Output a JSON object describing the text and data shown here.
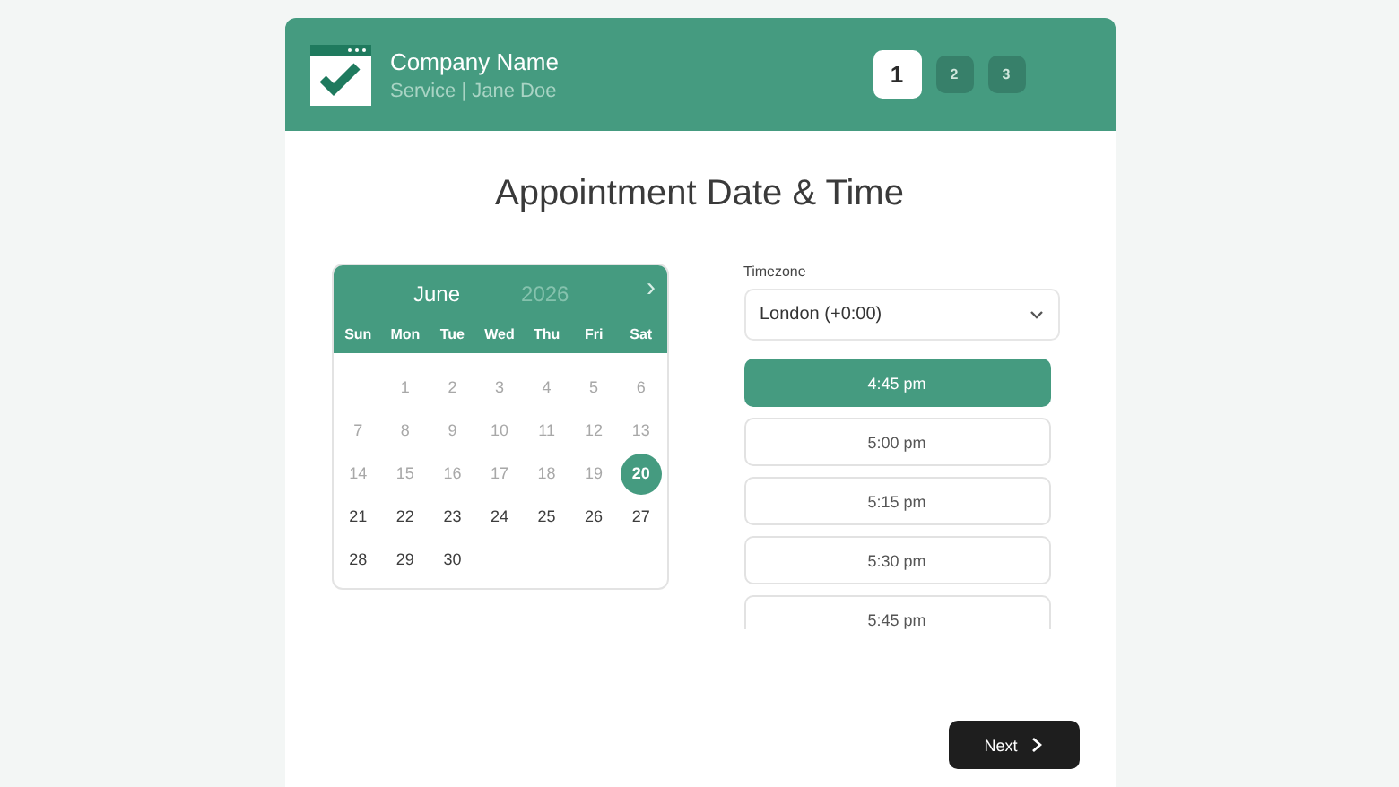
{
  "header": {
    "company": "Company Name",
    "subtitle": "Service | Jane Doe",
    "steps": [
      {
        "label": "1",
        "selected": true
      },
      {
        "label": "2",
        "selected": false
      },
      {
        "label": "3",
        "selected": false
      }
    ]
  },
  "title": "Appointment Date & Time",
  "calendar": {
    "month": "June",
    "year": "2026",
    "next": "›",
    "weekdays": [
      "Sun",
      "Mon",
      "Tue",
      "Wed",
      "Thu",
      "Fri",
      "Sat"
    ],
    "weeks": [
      {
        "days": [
          {
            "label": "1",
            "disabled": true,
            "selected": false
          },
          {
            "label": "2",
            "disabled": true,
            "selected": false
          },
          {
            "label": "3",
            "disabled": true,
            "selected": false
          },
          {
            "label": "4",
            "disabled": true,
            "selected": false
          },
          {
            "label": "5",
            "disabled": true,
            "selected": false
          },
          {
            "label": "6",
            "disabled": true,
            "selected": false
          }
        ]
      },
      {
        "days": [
          {
            "label": "7",
            "disabled": true,
            "selected": false
          },
          {
            "label": "8",
            "disabled": true,
            "selected": false
          },
          {
            "label": "9",
            "disabled": true,
            "selected": false
          },
          {
            "label": "10",
            "disabled": true,
            "selected": false
          },
          {
            "label": "11",
            "disabled": true,
            "selected": false
          },
          {
            "label": "12",
            "disabled": true,
            "selected": false
          },
          {
            "label": "13",
            "disabled": true,
            "selected": false
          }
        ]
      },
      {
        "days": [
          {
            "label": "14",
            "disabled": true,
            "selected": false
          },
          {
            "label": "15",
            "disabled": true,
            "selected": false
          },
          {
            "label": "16",
            "disabled": true,
            "selected": false
          },
          {
            "label": "17",
            "disabled": true,
            "selected": false
          },
          {
            "label": "18",
            "disabled": true,
            "selected": false
          },
          {
            "label": "19",
            "disabled": true,
            "selected": false
          },
          {
            "label": "20",
            "disabled": false,
            "selected": true
          }
        ]
      },
      {
        "days": [
          {
            "label": "21",
            "disabled": false,
            "selected": false
          },
          {
            "label": "22",
            "disabled": false,
            "selected": false
          },
          {
            "label": "23",
            "disabled": false,
            "selected": false
          },
          {
            "label": "24",
            "disabled": false,
            "selected": false
          },
          {
            "label": "25",
            "disabled": false,
            "selected": false
          },
          {
            "label": "26",
            "disabled": false,
            "selected": false
          },
          {
            "label": "27",
            "disabled": false,
            "selected": false
          }
        ]
      },
      {
        "days": [
          {
            "label": "28",
            "disabled": false,
            "selected": false
          },
          {
            "label": "29",
            "disabled": false,
            "selected": false
          },
          {
            "label": "30",
            "disabled": false,
            "selected": false
          }
        ]
      }
    ]
  },
  "timezone": {
    "label": "Timezone",
    "value": "London (+0:00)"
  },
  "times": [
    {
      "label": "4:45 pm",
      "selected": true
    },
    {
      "label": "5:00 pm",
      "selected": false
    },
    {
      "label": "5:15 pm",
      "selected": false
    },
    {
      "label": "5:30 pm",
      "selected": false
    },
    {
      "label": "5:45 pm",
      "selected": false
    }
  ],
  "next_button": "Next"
}
